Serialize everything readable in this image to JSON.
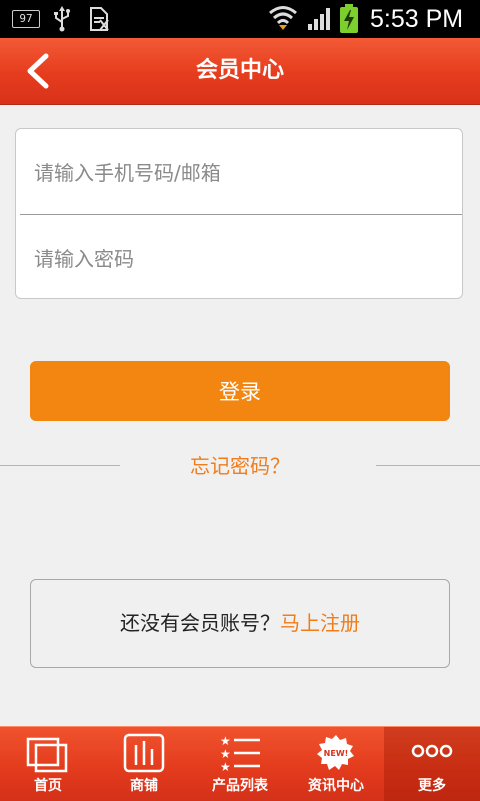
{
  "status_bar": {
    "badge": "97",
    "time": "5:53 PM",
    "icons": [
      "usb-icon",
      "document-icon",
      "wifi-icon",
      "signal-icon",
      "battery-charging-icon"
    ]
  },
  "header": {
    "title": "会员中心",
    "back_icon": "chevron-left-icon"
  },
  "login_form": {
    "phone_placeholder": "请输入手机号码/邮箱",
    "phone_value": "",
    "password_placeholder": "请输入密码",
    "password_value": "",
    "login_label": "登录",
    "forgot_label": "忘记密码？"
  },
  "register": {
    "prompt": "还没有会员账号？",
    "link": "马上注册"
  },
  "tabs": [
    {
      "label": "首页",
      "icon": "home-pages-icon"
    },
    {
      "label": "商铺",
      "icon": "store-icon"
    },
    {
      "label": "产品列表",
      "icon": "product-list-icon"
    },
    {
      "label": "资讯中心",
      "icon": "news-badge-icon"
    },
    {
      "label": "更多",
      "icon": "more-dots-icon"
    }
  ],
  "active_tab": "更多",
  "new_badge_text": "NEW!",
  "colors": {
    "header_red": "#e63c1e",
    "accent_orange": "#f28611",
    "link_orange": "#ef7d1b",
    "background": "#f0f0f0"
  }
}
